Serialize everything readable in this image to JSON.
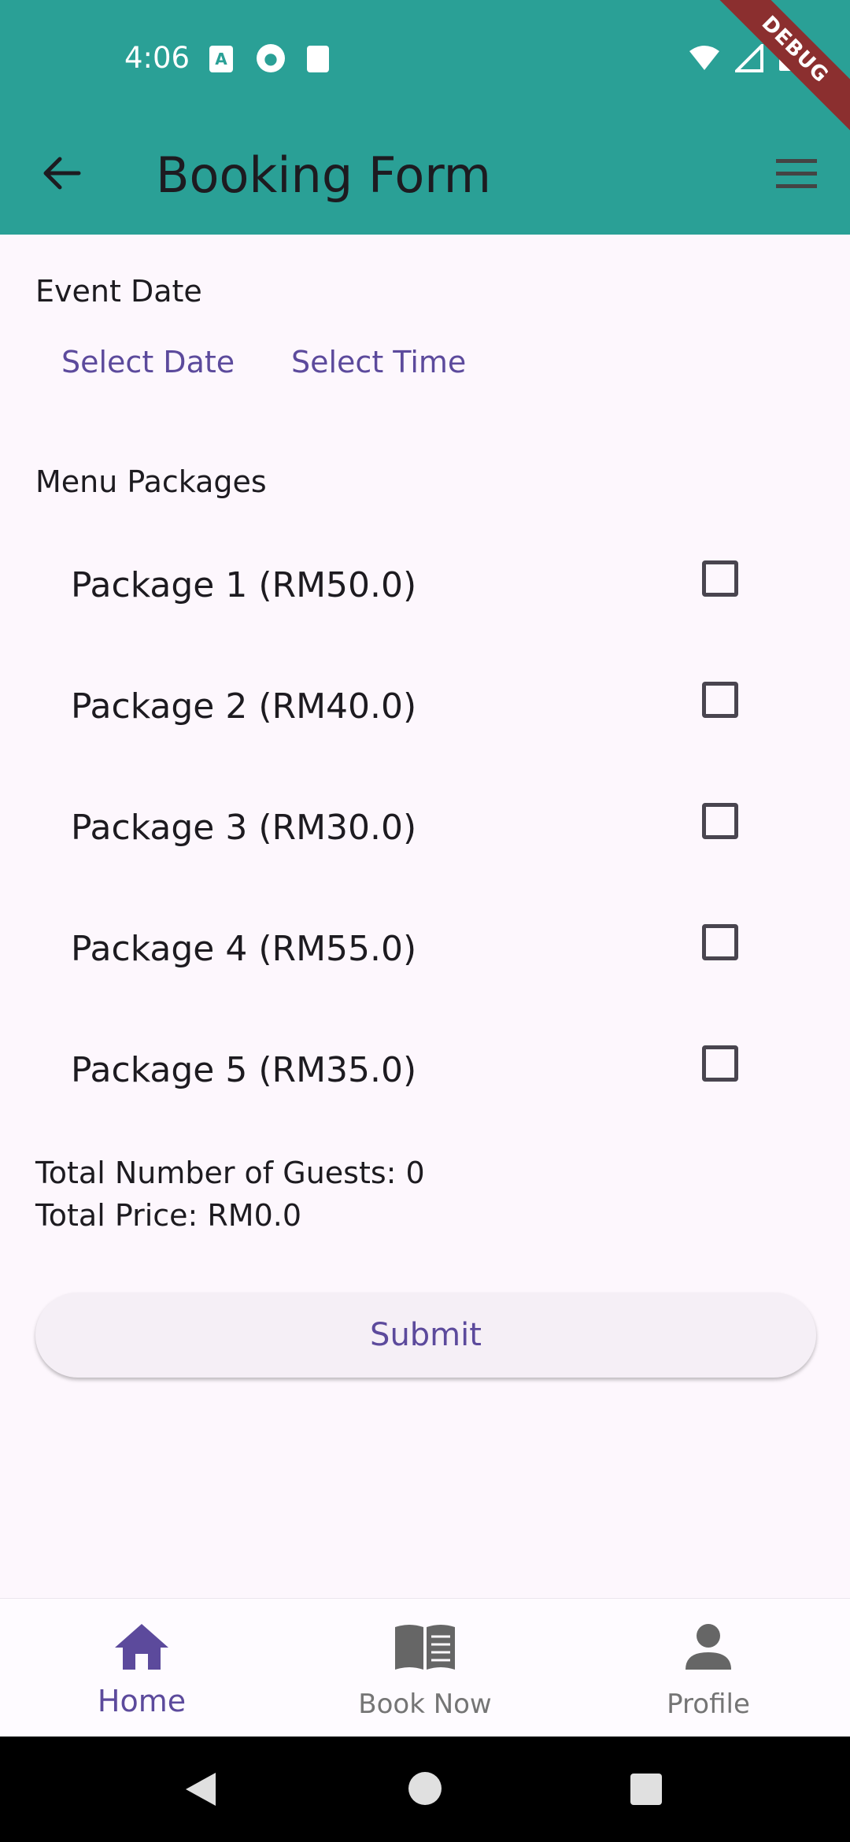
{
  "status_bar": {
    "time": "4:06",
    "debug_label": "DEBUG"
  },
  "app_bar": {
    "title": "Booking Form",
    "back_icon": "arrow-back-icon",
    "menu_icon": "menu-icon"
  },
  "event_date": {
    "label": "Event Date",
    "select_date": "Select Date",
    "select_time": "Select Time"
  },
  "menu_packages": {
    "label": "Menu Packages",
    "items": [
      {
        "label": "Package 1 (RM50.0)",
        "checked": false
      },
      {
        "label": "Package 2 (RM40.0)",
        "checked": false
      },
      {
        "label": "Package 3 (RM30.0)",
        "checked": false
      },
      {
        "label": "Package 4 (RM55.0)",
        "checked": false
      },
      {
        "label": "Package 5 (RM35.0)",
        "checked": false
      }
    ]
  },
  "summary": {
    "guests": "Total Number of Guests: 0",
    "price": "Total Price: RM0.0"
  },
  "submit_label": "Submit",
  "bottom_nav": {
    "items": [
      {
        "label": "Home",
        "icon": "home-icon",
        "active": true
      },
      {
        "label": "Book Now",
        "icon": "book-icon",
        "active": false
      },
      {
        "label": "Profile",
        "icon": "person-icon",
        "active": false
      }
    ]
  },
  "colors": {
    "app_bar": "#2aa096",
    "accent": "#5c4a9c",
    "background": "#fdf7fd"
  }
}
